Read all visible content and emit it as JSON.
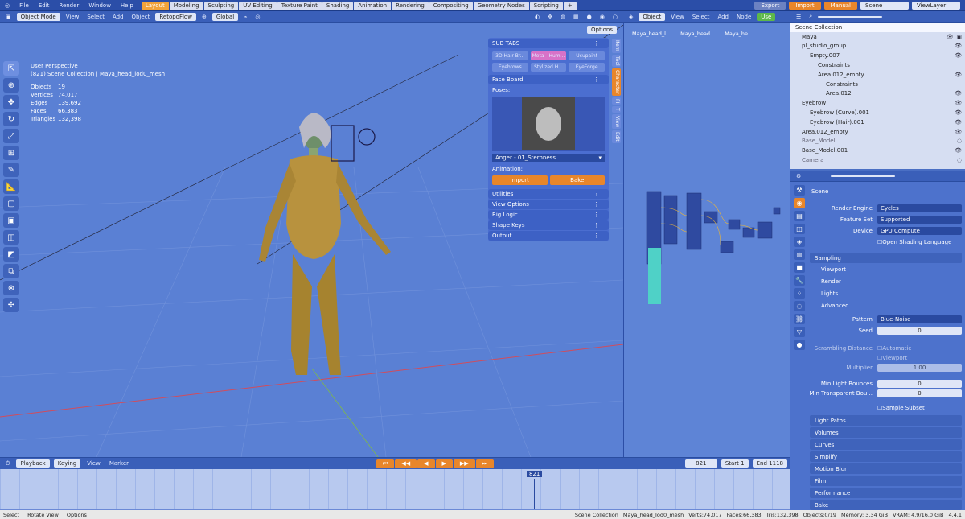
{
  "topbar": {
    "menus": [
      "File",
      "Edit",
      "Render",
      "Window",
      "Help"
    ],
    "workspaces": [
      "Layout",
      "Modeling",
      "Sculpting",
      "UV Editing",
      "Texture Paint",
      "Shading",
      "Animation",
      "Rendering",
      "Compositing",
      "Geometry Nodes",
      "Scripting"
    ],
    "active_workspace": "Layout",
    "export_label": "Export",
    "import_label": "Import",
    "manual_label": "Manual",
    "scene_value": "Scene",
    "viewlayer_value": "ViewLayer"
  },
  "viewport_header": {
    "mode": "Object Mode",
    "menus": [
      "View",
      "Select",
      "Add",
      "Object"
    ],
    "retopoflow": "RetopoFlow",
    "orientation": "Global",
    "options": "Options"
  },
  "viewport_info": {
    "perspective": "User Perspective",
    "collection": "(821) Scene Collection | Maya_head_lod0_mesh",
    "stats": [
      {
        "label": "Objects",
        "value": "19"
      },
      {
        "label": "Vertices",
        "value": "74,017"
      },
      {
        "label": "Edges",
        "value": "139,692"
      },
      {
        "label": "Faces",
        "value": "66,383"
      },
      {
        "label": "Triangles",
        "value": "132,398"
      }
    ]
  },
  "npanel": {
    "subtabs_title": "SUB TABS",
    "subtabs": [
      "3D Hair Br...",
      "Meta - Hum...",
      "Ucupaint",
      "Eyebrows",
      "Stylized H...",
      "EyeForge"
    ],
    "faceboard_title": "Face Board",
    "poses_label": "Poses:",
    "pose_value": "Anger - 01_Sternness",
    "animation_label": "Animation:",
    "import_btn": "Import",
    "bake_btn": "Bake",
    "sections": [
      "Utilities",
      "View Options",
      "Rig Logic",
      "Shape Keys",
      "Output"
    ],
    "side_tabs": [
      "Item",
      "Tool",
      "Character",
      "FI",
      "T",
      "View",
      "Edit"
    ]
  },
  "node_header": {
    "type": "Object",
    "menus": [
      "View",
      "Select",
      "Add",
      "Node"
    ],
    "use_nodes": "Use",
    "breadcrumbs": [
      "Maya_head_l...",
      "Maya_head...",
      "Maya_he..."
    ]
  },
  "outliner": {
    "search_placeholder": "",
    "rows": [
      {
        "name": "Scene Collection",
        "indent": 0
      },
      {
        "name": "Maya",
        "indent": 1
      },
      {
        "name": "pl_studio_group",
        "indent": 1
      },
      {
        "name": "Empty.007",
        "indent": 2
      },
      {
        "name": "Constraints",
        "indent": 3
      },
      {
        "name": "Area.012_empty",
        "indent": 3
      },
      {
        "name": "Constraints",
        "indent": 4
      },
      {
        "name": "Area.012",
        "indent": 4
      },
      {
        "name": "Eyebrow",
        "indent": 1
      },
      {
        "name": "Eyebrow (Curve).001",
        "indent": 2
      },
      {
        "name": "Eyebrow (Hair).001",
        "indent": 2
      },
      {
        "name": "Area.012_empty",
        "indent": 1
      },
      {
        "name": "Base_Model",
        "indent": 1
      },
      {
        "name": "Base_Model.001",
        "indent": 1
      },
      {
        "name": "Camera",
        "indent": 1
      }
    ]
  },
  "properties": {
    "scene_label": "Scene",
    "render_engine_label": "Render Engine",
    "render_engine": "Cycles",
    "feature_set_label": "Feature Set",
    "feature_set": "Supported",
    "device_label": "Device",
    "device": "GPU Compute",
    "osl_label": "Open Shading Language",
    "sampling": "Sampling",
    "sampling_items": [
      "Viewport",
      "Render",
      "Lights",
      "Advanced"
    ],
    "pattern_label": "Pattern",
    "pattern": "Blue-Noise",
    "seed_label": "Seed",
    "seed": "0",
    "scrambling_label": "Scrambling Distance",
    "automatic_label": "Automatic",
    "viewport_label": "Viewport",
    "multiplier_label": "Multiplier",
    "multiplier": "1.00",
    "min_light_label": "Min Light Bounces",
    "min_light": "0",
    "min_transparent_label": "Min Transparent Bou...",
    "min_transparent": "0",
    "sample_subset": "Sample Subset",
    "sections": [
      "Light Paths",
      "Volumes",
      "Curves",
      "Simplify",
      "Motion Blur",
      "Film",
      "Performance",
      "Bake"
    ]
  },
  "timeline": {
    "menus": [
      "Playback",
      "Keying",
      "View",
      "Marker"
    ],
    "current_frame": "821",
    "start_label": "Start",
    "start": "1",
    "end_label": "End",
    "end": "1118"
  },
  "statusbar": {
    "select": "Select",
    "rotate": "Rotate View",
    "options": "Options",
    "collection": "Scene Collection",
    "object": "Maya_head_lod0_mesh",
    "verts": "Verts:74,017",
    "faces": "Faces:66,383",
    "tris": "Tris:132,398",
    "objects": "Objects:0/19",
    "memory": "Memory: 3.34 GiB",
    "vram": "VRAM: 4.9/16.0 GiB",
    "version": "4.4.1"
  }
}
